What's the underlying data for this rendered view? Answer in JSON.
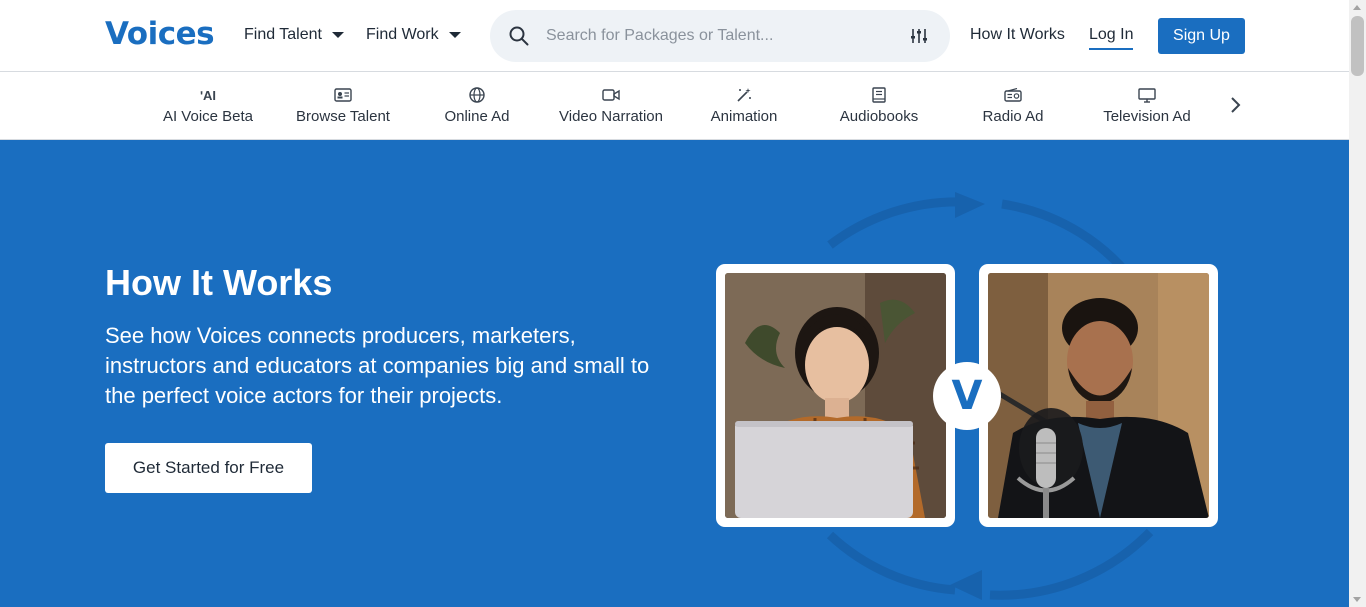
{
  "header": {
    "logo": "Voices",
    "find_talent": "Find Talent",
    "find_work": "Find Work",
    "search_placeholder": "Search for Packages or Talent...",
    "how_it_works": "How It Works",
    "log_in": "Log In",
    "sign_up": "Sign Up"
  },
  "categories": [
    {
      "label": "AI Voice Beta",
      "icon": "ai-icon"
    },
    {
      "label": "Browse Talent",
      "icon": "id-card-icon"
    },
    {
      "label": "Online Ad",
      "icon": "globe-icon"
    },
    {
      "label": "Video Narration",
      "icon": "video-camera-icon"
    },
    {
      "label": "Animation",
      "icon": "magic-wand-icon"
    },
    {
      "label": "Audiobooks",
      "icon": "book-icon"
    },
    {
      "label": "Radio Ad",
      "icon": "radio-icon"
    },
    {
      "label": "Television Ad",
      "icon": "tv-icon"
    }
  ],
  "hero": {
    "title": "How It Works",
    "subtitle": "See how Voices connects producers, marketers, instructors and educators at companies big and small to the perfect voice actors for their projects.",
    "cta": "Get Started for Free",
    "badge": "V"
  },
  "colors": {
    "brand": "#1a6ec0",
    "text": "#1f2a37"
  }
}
